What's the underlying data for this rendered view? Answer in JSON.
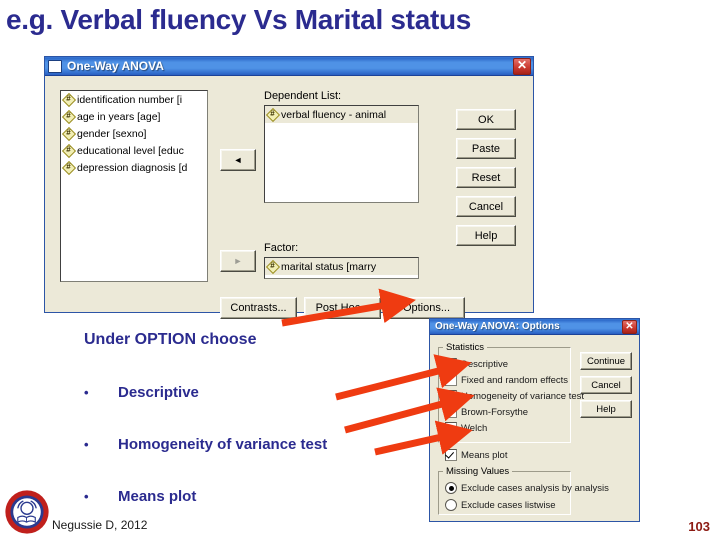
{
  "slide": {
    "title": "e.g.  Verbal fluency Vs Marital status",
    "title_color": "#2b2b8f",
    "page_number": "103",
    "credit": "Negussie D, 2012",
    "logo_name": "university-seal-logo"
  },
  "main_dialog": {
    "title": "One-Way ANOVA",
    "close_label": "✕",
    "source_variables": [
      {
        "label": "identification number [i",
        "icon": "scale-variable-icon"
      },
      {
        "label": "age in years [age]",
        "icon": "scale-variable-icon"
      },
      {
        "label": "gender [sexno]",
        "icon": "scale-variable-icon"
      },
      {
        "label": "educational level [educ",
        "icon": "scale-variable-icon"
      },
      {
        "label": "depression diagnosis [d",
        "icon": "scale-variable-icon"
      }
    ],
    "transfer_buttons": [
      {
        "name": "move-to-dependent-button",
        "glyph": "◄",
        "enabled": true
      },
      {
        "name": "move-to-factor-button",
        "glyph": "►",
        "enabled": false
      }
    ],
    "dependent_list": {
      "label": "Dependent List:",
      "items": [
        {
          "label": "verbal fluency - animal",
          "icon": "scale-variable-icon"
        }
      ]
    },
    "factor": {
      "label": "Factor:",
      "value": "marital status [marry",
      "icon": "scale-variable-icon"
    },
    "side_buttons": [
      {
        "label": "OK",
        "name": "ok-button"
      },
      {
        "label": "Paste",
        "name": "paste-button"
      },
      {
        "label": "Reset",
        "name": "reset-button"
      },
      {
        "label": "Cancel",
        "name": "cancel-button"
      },
      {
        "label": "Help",
        "name": "help-button"
      }
    ],
    "bottom_buttons": [
      {
        "label": "Contrasts...",
        "name": "contrasts-button"
      },
      {
        "label": "Post Hoc...",
        "name": "post-hoc-button"
      },
      {
        "label": "Options...",
        "name": "options-button"
      }
    ]
  },
  "options_dialog": {
    "title": "One-Way ANOVA: Options",
    "close_label": "✕",
    "statistics_group": "Statistics",
    "statistics": [
      {
        "label": "Descriptive",
        "checked": true
      },
      {
        "label": "Fixed and random effects",
        "checked": false
      },
      {
        "label": "Homogeneity of variance test",
        "checked": true
      },
      {
        "label": "Brown-Forsythe",
        "checked": false
      },
      {
        "label": "Welch",
        "checked": false
      }
    ],
    "means_plot": {
      "label": "Means plot",
      "checked": true
    },
    "missing_group": "Missing Values",
    "missing_options": [
      {
        "label": "Exclude cases analysis by analysis",
        "selected": true
      },
      {
        "label": "Exclude cases listwise",
        "selected": false
      }
    ],
    "side_buttons": [
      {
        "label": "Continue",
        "name": "continue-button"
      },
      {
        "label": "Cancel",
        "name": "options-cancel-button"
      },
      {
        "label": "Help",
        "name": "options-help-button"
      }
    ]
  },
  "annotations": {
    "heading": "Under OPTION choose",
    "bullet_char": "•",
    "bullets": [
      "Descriptive",
      "Homogeneity of variance test",
      "Means plot"
    ],
    "arrow_color": "#ef3b11"
  }
}
